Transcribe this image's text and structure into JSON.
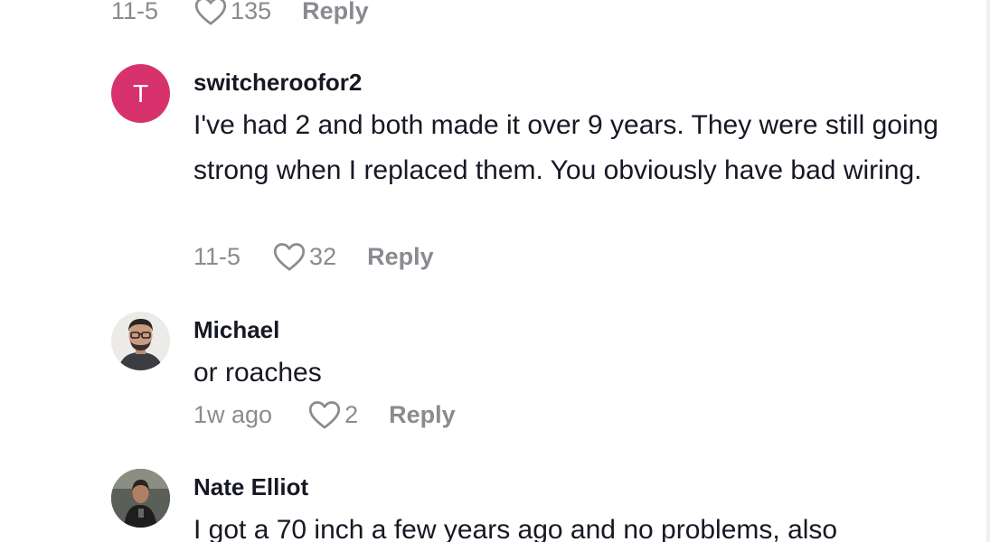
{
  "comments": [
    {
      "username": "",
      "text": "",
      "date": "11-5",
      "likes": "135",
      "reply_label": "Reply"
    },
    {
      "username": "switcheroofor2",
      "avatar_letter": "T",
      "avatar_color": "#d8326c",
      "text": "I've had 2 and both made it over 9 years. They were still going strong when I replaced them. You obviously have bad wiring.",
      "date": "11-5",
      "likes": "32",
      "reply_label": "Reply"
    },
    {
      "username": "Michael",
      "text": "or roaches",
      "date": "1w ago",
      "likes": "2",
      "reply_label": "Reply"
    },
    {
      "username": "Nate Elliot",
      "text": "I got a 70 inch a few years ago and no problems, also",
      "date": "",
      "likes": "",
      "reply_label": ""
    }
  ],
  "colors": {
    "text_primary": "#161823",
    "text_secondary": "#8a8b91",
    "avatar_t": "#d8326c"
  }
}
